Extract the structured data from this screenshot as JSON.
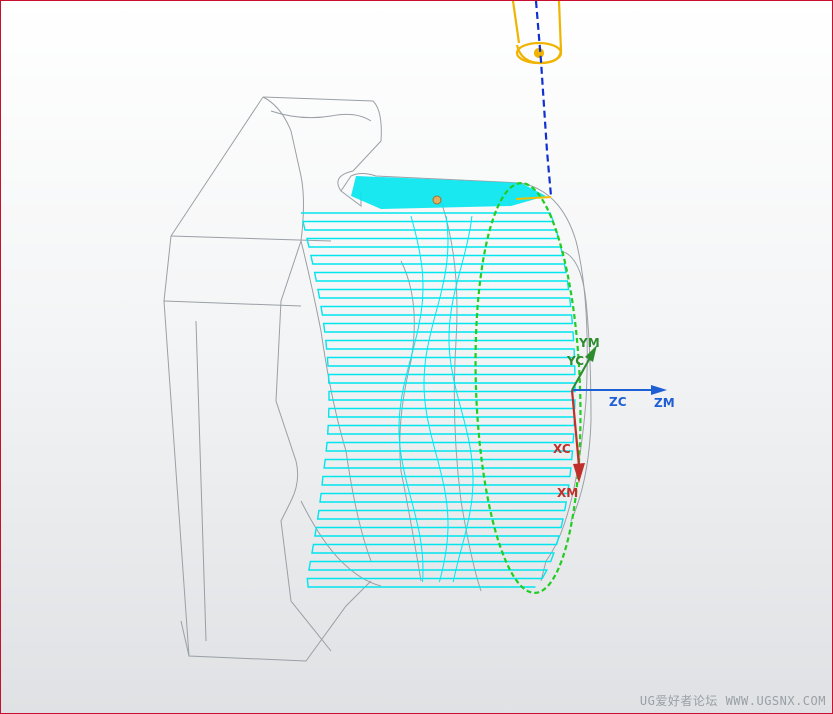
{
  "axes": {
    "zc_label": "ZC",
    "zm_label": "ZM",
    "ym_label": "YM",
    "yc_label": "YC",
    "xc_label": "XC",
    "xm_label": "XM"
  },
  "watermark": "UG爱好者论坛 WWW.UGSNX.COM",
  "colors": {
    "border": "#c8102e",
    "toolpath": "#00e5ee",
    "part_edge": "#9aa0a6",
    "tool": "#f0b400",
    "tool_axis": "#1030d0",
    "boundary": "#22cc22",
    "x_axis": "#c0302a",
    "y_axis": "#2e8b2e",
    "z_axis": "#1f5fd6"
  },
  "icons": [
    "cutting-tool-icon",
    "coordinate-system-icon"
  ]
}
